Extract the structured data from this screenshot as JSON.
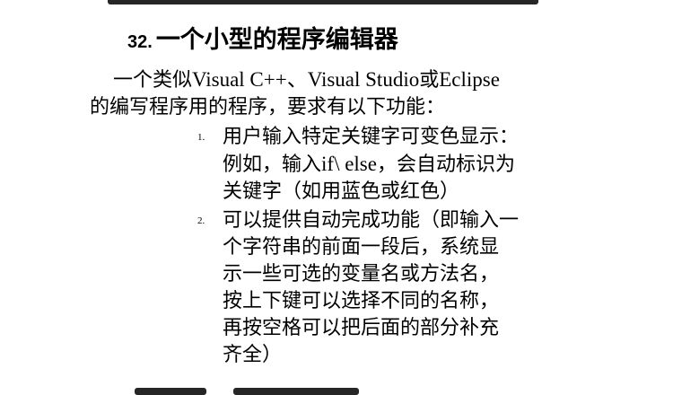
{
  "slide": {
    "title_number": "32.",
    "title_text": "一个小型的程序编辑器",
    "intro_line1_a": "一个类似",
    "intro_line1_b": "Visual C++、Visual Studio",
    "intro_line1_c": "或",
    "intro_line1_d": "Eclipse",
    "intro_line2": "的编写程序用的程序，要求有以下功能：",
    "items": [
      {
        "marker": "1.",
        "line1": "用户输入特定关键字可变色显示：",
        "line2_a": "例如，输入",
        "line2_b": "if\\ else",
        "line2_c": "，会自动标识为",
        "line3": "关键字（如用蓝色或红色）"
      },
      {
        "marker": "2.",
        "line1": "可以提供自动完成功能（即输入一",
        "line2": "个字符串的前面一段后，系统显",
        "line3": "示一些可选的变量名或方法名，",
        "line4": "按上下键可以选择不同的名称，",
        "line5": "再按空格可以把后面的部分补充",
        "line6": "齐全）"
      }
    ]
  }
}
